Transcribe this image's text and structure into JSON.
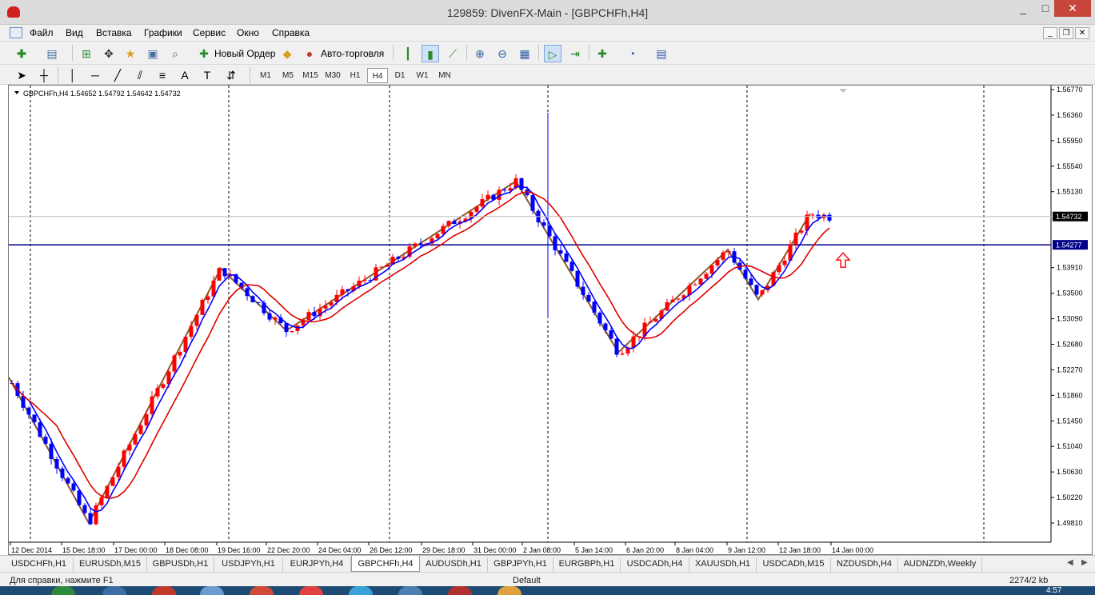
{
  "window": {
    "title": "129859: DivenFX-Main - [GBPCHFh,H4]",
    "minimize": "_",
    "maximize": "□",
    "close": "✕"
  },
  "menu": [
    "Файл",
    "Вид",
    "Вставка",
    "Графики",
    "Сервис",
    "Окно",
    "Справка"
  ],
  "mdi": {
    "minimize": "_",
    "restore": "❐",
    "close": "✕"
  },
  "toolbar": {
    "new_order": "Новый Ордер",
    "auto_trading": "Авто-торговля",
    "help_icon": "help-icon",
    "search_icon": "search-icon"
  },
  "timeframes": [
    "M1",
    "M5",
    "M15",
    "M30",
    "H1",
    "H4",
    "D1",
    "W1",
    "MN"
  ],
  "active_timeframe": "H4",
  "tools": {
    "text_tool": "A"
  },
  "chart": {
    "info": "GBPCHFh,H4  1.54652 1.54792 1.54642 1.54732",
    "current_price": "1.54732",
    "line_price": "1.54277",
    "price_labels": [
      "1.56770",
      "1.56360",
      "1.55950",
      "1.55540",
      "1.55130",
      "1.54732",
      "1.54277",
      "1.53910",
      "1.53500",
      "1.53090",
      "1.52680",
      "1.52270",
      "1.51860",
      "1.51450",
      "1.51040",
      "1.50630",
      "1.50220",
      "1.49810"
    ],
    "time_labels": [
      "12 Dec 2014",
      "15 Dec 18:00",
      "17 Dec 00:00",
      "18 Dec 08:00",
      "19 Dec 16:00",
      "22 Dec 20:00",
      "24 Dec 04:00",
      "26 Dec 12:00",
      "29 Dec 18:00",
      "31 Dec 00:00",
      "2 Jan 08:00",
      "5 Jan 14:00",
      "6 Jan 20:00",
      "8 Jan 04:00",
      "9 Jan 12:00",
      "12 Jan 18:00",
      "14 Jan 00:00"
    ],
    "colors": {
      "bull": "#ff0000",
      "bear": "#0000ff",
      "zigzag": "#8b5a2b",
      "ma_fast": "#0000ff",
      "ma_slow": "#e00000",
      "hline": "#00008b",
      "arrow": "#ff0000"
    },
    "ylim": [
      1.4981,
      1.5677
    ]
  },
  "tabs": [
    "USDCHFh,H1",
    "EURUSDh,M15",
    "GBPUSDh,H1",
    "USDJPYh,H1",
    "EURJPYh,H4",
    "GBPCHFh,H4",
    "AUDUSDh,H1",
    "GBPJPYh,H1",
    "EURGBPh,H1",
    "USDCADh,H4",
    "XAUUSDh,H1",
    "USDCADh,M15",
    "NZDUSDh,H4",
    "AUDNZDh,Weekly"
  ],
  "active_tab": "GBPCHFh,H4",
  "tab_nav": {
    "prev": "◀",
    "next": "▶"
  },
  "status": {
    "help": "Для справки, нажмите F1",
    "profile": "Default",
    "traffic": "2274/2 kb"
  },
  "taskbar": {
    "clock": "4:57"
  }
}
